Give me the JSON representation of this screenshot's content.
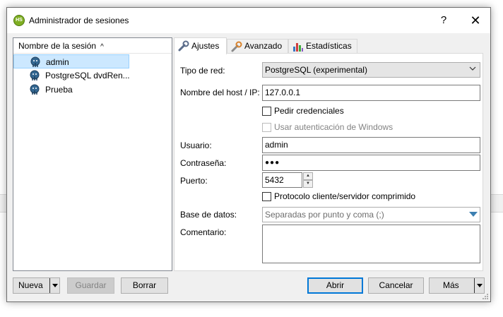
{
  "window": {
    "title": "Administrador de sesiones",
    "help_glyph": "?",
    "close_glyph": "✕",
    "app_icon_text": "HS"
  },
  "session_tree": {
    "header": "Nombre de la sesión",
    "sort_glyph": "^",
    "items": [
      {
        "label": "admin",
        "selected": true,
        "icon": "postgresql-elephant-icon"
      },
      {
        "label": "PostgreSQL dvdRen...",
        "selected": false,
        "icon": "postgresql-elephant-icon"
      },
      {
        "label": "Prueba",
        "selected": false,
        "icon": "postgresql-elephant-icon"
      }
    ]
  },
  "tabs": [
    {
      "label": "Ajustes",
      "icon": "wrench-icon",
      "active": true
    },
    {
      "label": "Avanzado",
      "icon": "wrench-orange-icon",
      "active": false
    },
    {
      "label": "Estadísticas",
      "icon": "bar-chart-icon",
      "active": false
    }
  ],
  "settings": {
    "network_type_label": "Tipo de red:",
    "network_type_value": "PostgreSQL (experimental)",
    "host_label": "Nombre del host / IP:",
    "host_value": "127.0.0.1",
    "ask_credentials_label": "Pedir credenciales",
    "ask_credentials_checked": false,
    "windows_auth_label": "Usar autenticación de Windows",
    "windows_auth_checked": false,
    "windows_auth_enabled": false,
    "user_label": "Usuario:",
    "user_value": "admin",
    "password_label": "Contraseña:",
    "password_value": "●●●",
    "port_label": "Puerto:",
    "port_value": "5432",
    "spin_up_glyph": "▲",
    "spin_down_glyph": "▼",
    "compressed_label": "Protocolo cliente/servidor comprimido",
    "compressed_checked": false,
    "databases_label": "Base de datos:",
    "databases_placeholder": "Separadas por punto y coma (;)",
    "comment_label": "Comentario:",
    "comment_value": ""
  },
  "buttons": {
    "new": "Nueva",
    "save": "Guardar",
    "delete": "Borrar",
    "open": "Abrir",
    "cancel": "Cancelar",
    "more": "Más"
  },
  "colors": {
    "selection_bg": "#cce8ff",
    "selection_border": "#99d1ff",
    "primary_button_border": "#0078d7",
    "dropdown_triangle": "#3c7fb1"
  }
}
